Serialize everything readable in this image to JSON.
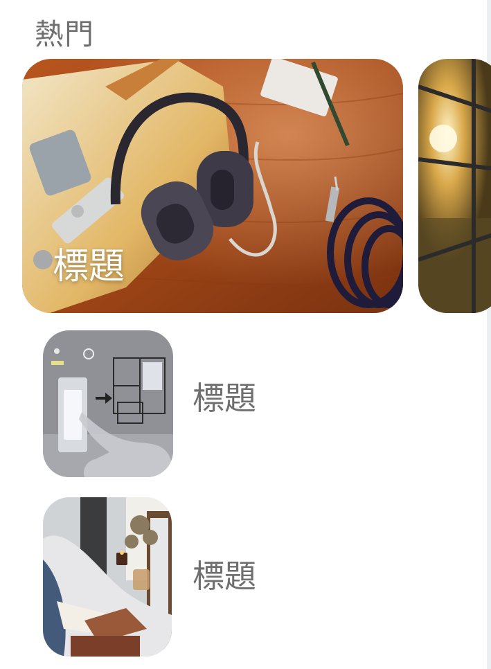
{
  "section": {
    "title": "熱門"
  },
  "featured": {
    "title": "標題",
    "image": "guitar-headphones-photo"
  },
  "next_featured": {
    "image": "restaurant-window-photo"
  },
  "list": [
    {
      "title": "標題",
      "image": "light-switch-floorplan-photo"
    },
    {
      "title": "標題",
      "image": "bed-books-candle-photo"
    }
  ],
  "colors": {
    "title_text": "#6f6f6f",
    "overlay_text": "#ffffff",
    "background": "#ffffff"
  }
}
